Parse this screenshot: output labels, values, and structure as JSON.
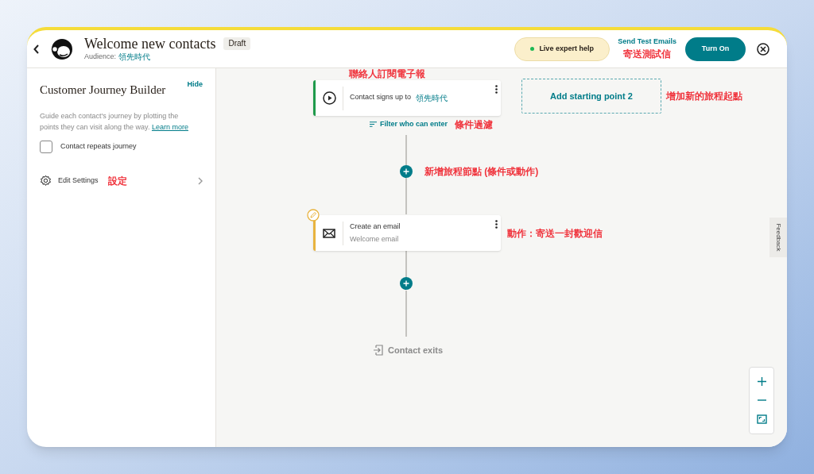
{
  "header": {
    "title": "Welcome new contacts",
    "status_badge": "Draft",
    "audience_label": "Audience:",
    "audience": "領先時代",
    "live_help": "Live expert help",
    "send_test": "Send Test Emails",
    "send_test_note": "寄送測試信",
    "turn_on": "Turn On"
  },
  "sidebar": {
    "title": "Customer Journey Builder",
    "hide": "Hide",
    "description": "Guide each contact's journey by plotting the points they can visit along the way.",
    "learn_more": "Learn more",
    "repeat": {
      "label": "Contact repeats journey",
      "checked": false
    },
    "settings": "Edit Settings",
    "settings_note": "設定"
  },
  "canvas": {
    "nodes": [
      {
        "kind": "trigger",
        "title": "Contact signs up to",
        "value": "領先時代",
        "note": "聯絡人訂閱電子報"
      },
      {
        "kind": "action",
        "title": "Create an email",
        "subtitle": "Welcome email",
        "note": "動作：寄送一封歡迎信"
      }
    ],
    "add_starting_point": "Add starting point 2",
    "add_starting_point_note": "增加新的旅程起點",
    "filter": "Filter who can enter",
    "filter_note": "條件過濾",
    "add_step_note": "新增旅程節點 (條件或動作)",
    "exit": "Contact exits",
    "feedback": "Feedback"
  }
}
